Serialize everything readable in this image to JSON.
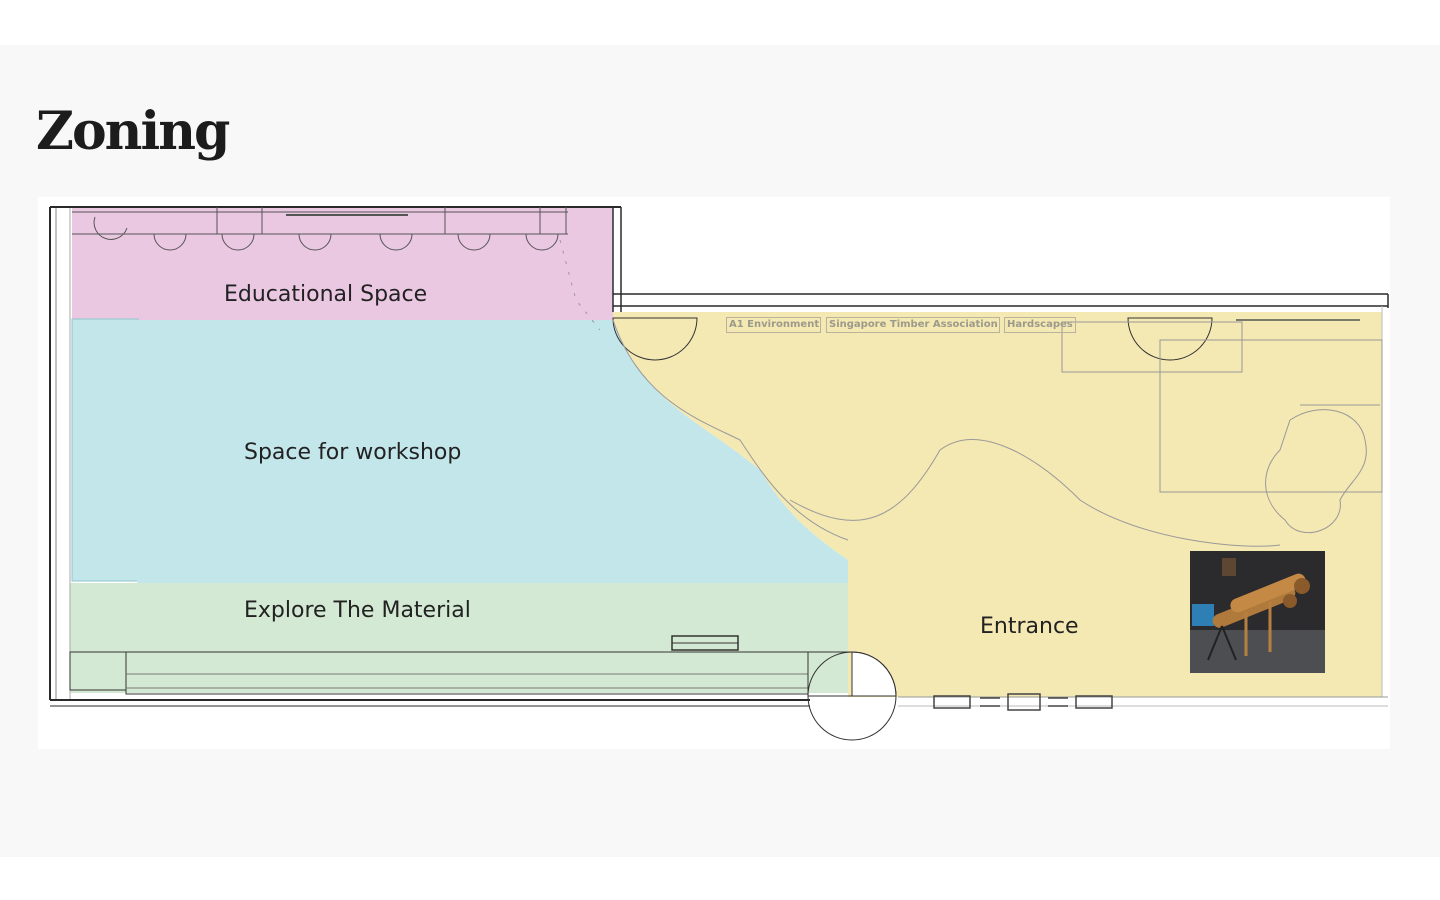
{
  "page": {
    "title": "Zoning"
  },
  "zones": {
    "educational": "Educational Space",
    "workshop": "Space for workshop",
    "explore": "Explore The Material",
    "entrance": "Entrance"
  },
  "booths": [
    "A1 Environment",
    "Singapore Timber Association",
    "Hardscapes"
  ],
  "colors": {
    "educational": "#ebc8e2",
    "workshop": "#c2e6ea",
    "explore": "#d4e9d3",
    "entrance": "#f4e8b3"
  },
  "photo": {
    "icon": "wooden-telescope-installation-photo"
  }
}
